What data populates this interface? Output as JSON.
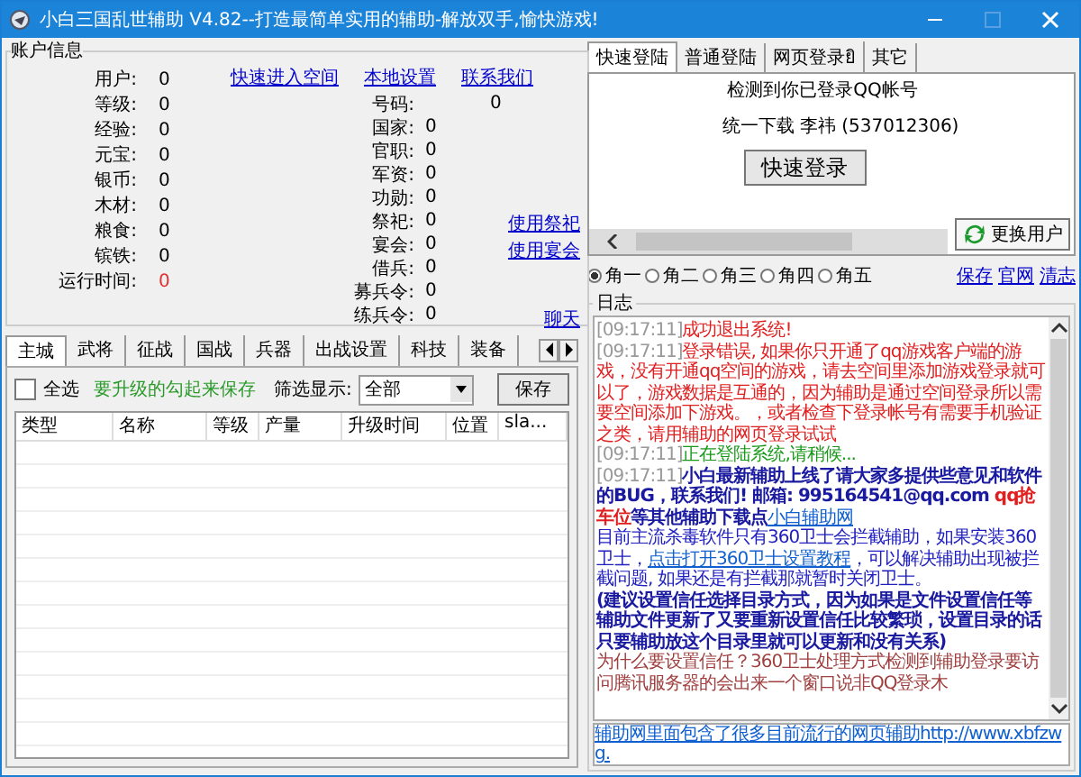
{
  "window": {
    "title": "小白三国乱世辅助 V4.82--打造最简单实用的辅助-解放双手,愉快游戏!"
  },
  "account": {
    "title": "账户信息",
    "top_links": [
      "快速进入空间",
      "本地设置",
      "联系我们"
    ],
    "left_fields": [
      {
        "label": "用户:",
        "value": "0",
        "alert": false
      },
      {
        "label": "等级:",
        "value": "0",
        "alert": false
      },
      {
        "label": "经验:",
        "value": "0",
        "alert": false
      },
      {
        "label": "元宝:",
        "value": "0",
        "alert": false
      },
      {
        "label": "银币:",
        "value": "0",
        "alert": false
      },
      {
        "label": "木材:",
        "value": "0",
        "alert": false
      },
      {
        "label": "粮食:",
        "value": "0",
        "alert": false
      },
      {
        "label": "镔铁:",
        "value": "0",
        "alert": false
      },
      {
        "label": "运行时间:",
        "value": "0",
        "alert": true
      }
    ],
    "number": {
      "label": "号码:",
      "value": "0"
    },
    "right_fields": [
      {
        "label": "国家:",
        "value": "0"
      },
      {
        "label": "官职:",
        "value": "0"
      },
      {
        "label": "军资:",
        "value": "0"
      },
      {
        "label": "功勋:",
        "value": "0"
      },
      {
        "label": "祭祀:",
        "value": "0"
      },
      {
        "label": "宴会:",
        "value": "0"
      },
      {
        "label": "借兵:",
        "value": "0"
      },
      {
        "label": "募兵令:",
        "value": "0"
      },
      {
        "label": "练兵令:",
        "value": "0"
      }
    ],
    "side_links": [
      "使用祭祀",
      "使用宴会",
      "聊天"
    ]
  },
  "main_tabs": [
    {
      "label": "主城",
      "selected": true
    },
    {
      "label": "武将",
      "selected": false
    },
    {
      "label": "征战",
      "selected": false
    },
    {
      "label": "国战",
      "selected": false
    },
    {
      "label": "兵器",
      "selected": false
    },
    {
      "label": "出战设置",
      "selected": false
    },
    {
      "label": "科技",
      "selected": false
    },
    {
      "label": "装备",
      "selected": false
    }
  ],
  "toolbar": {
    "select_all": {
      "label": "全选",
      "checked": false
    },
    "hint": "要升级的勾起来保存",
    "filter_label": "筛选显示:",
    "filter_value": "全部",
    "save": "保存"
  },
  "table": {
    "columns": [
      "类型",
      "名称",
      "等级",
      "产量",
      "升级时间",
      "位置",
      "sla..."
    ]
  },
  "login_tabs": [
    {
      "label": "快速登陆",
      "selected": true
    },
    {
      "label": "普通登陆",
      "selected": false
    },
    {
      "label": "网页登录ยิ",
      "selected": false
    },
    {
      "label": "其它",
      "selected": false
    }
  ],
  "login": {
    "detected": "检测到你已登录QQ帐号",
    "account": "统一下载 李祎 (537012306)",
    "login_button": "快速登录",
    "switch_button": "更换用户"
  },
  "roles": [
    {
      "label": "角一",
      "selected": true
    },
    {
      "label": "角二",
      "selected": false
    },
    {
      "label": "角三",
      "selected": false
    },
    {
      "label": "角四",
      "selected": false
    },
    {
      "label": "角五",
      "selected": false
    }
  ],
  "role_links": [
    "保存",
    "官网",
    "清志"
  ],
  "log": {
    "title": "日志",
    "entries": [
      {
        "time": "[09:17:11]",
        "segments": [
          {
            "kind": "red",
            "text": "成功退出系统!"
          }
        ]
      },
      {
        "time": "[09:17:11]",
        "segments": [
          {
            "kind": "red",
            "text": "登录错误, 如果你只开通了qq游戏客户端的游戏，没有开通qq空间的游戏，请去空间里添加游戏登录就可以了，游戏数据是互通的，因为辅助是通过空间登录所以需要空间添加下游戏。，或者检查下登录帐号有需要手机验证之类，请用辅助的网页登录试试"
          }
        ]
      },
      {
        "time": "[09:17:11]",
        "segments": [
          {
            "kind": "green",
            "text": "正在登陆系统,请稍候..."
          }
        ]
      },
      {
        "time": "[09:17:11]",
        "segments": [
          {
            "kind": "bold",
            "text": "小白最新辅助上线了请大家多提供些意见和软件的BUG，联系我们! 邮箱: 995164541@qq.com "
          },
          {
            "kind": "boldred",
            "text": "qq抢车位"
          },
          {
            "kind": "bold",
            "text": "等其他辅助下载点"
          },
          {
            "kind": "link",
            "text": "小白辅助网"
          }
        ]
      },
      {
        "segments": [
          {
            "kind": "blue",
            "text": "目前主流杀毒软件只有360卫士会拦截辅助，如果安装360卫士，"
          },
          {
            "kind": "link",
            "text": "点击打开360卫士设置教程"
          },
          {
            "kind": "blue",
            "text": "，可以解决辅助出现被拦截问题, 如果还是有拦截那就暂时关闭卫士。"
          }
        ]
      },
      {
        "segments": [
          {
            "kind": "bold",
            "text": "(建议设置信任选择目录方式，因为如果是文件设置信任等辅助文件更新了又要重新设置信任比较繁琐，设置目录的话只要辅助放这个目录里就可以更新和没有关系)"
          }
        ]
      },
      {
        "segments": [
          {
            "kind": "brown",
            "text": "为什么要设置信任？360卫士处理方式检测到辅助登录要访问腾讯服务器的会出来一个窗口说非QQ登录木"
          }
        ]
      }
    ],
    "footer_link": "辅助网里面包含了很多目前流行的网页辅助http://www.xbfzwg."
  }
}
